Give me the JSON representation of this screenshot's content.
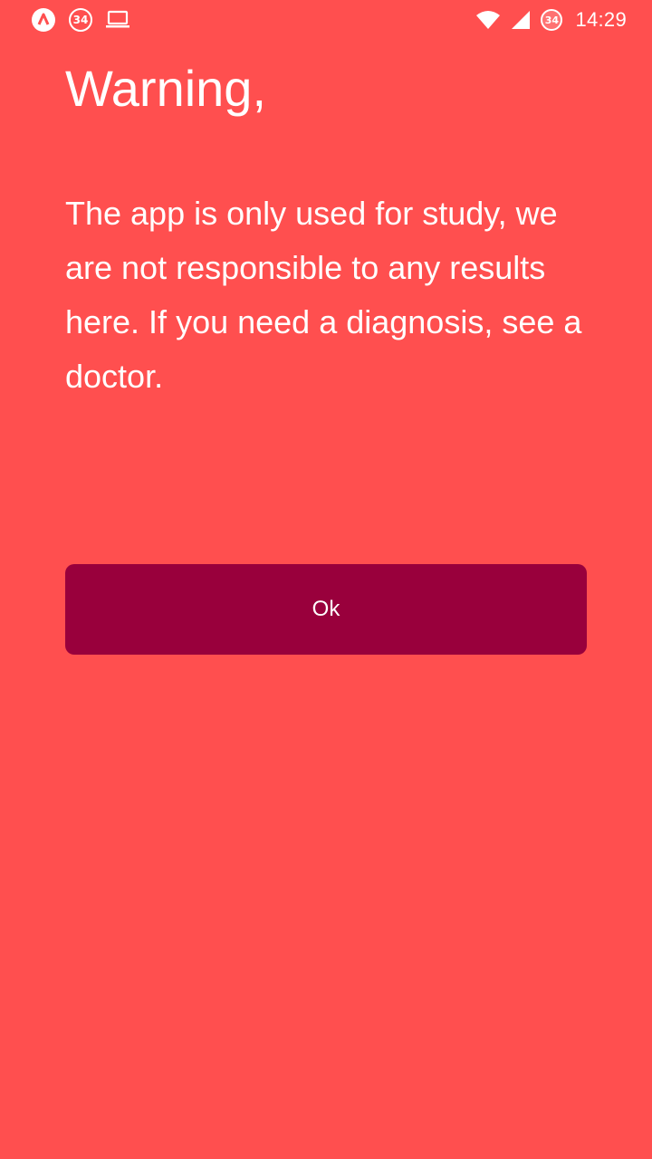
{
  "status_bar": {
    "left_icons": [
      "app-logo-icon",
      "notification-badge-icon",
      "laptop-icon"
    ],
    "notification_badge_text": "34",
    "right_icons": [
      "wifi-icon",
      "cell-signal-icon",
      "notification-badge-icon"
    ],
    "right_badge_text": "34",
    "time": "14:29"
  },
  "dialog": {
    "title": "Warning,",
    "message": "The app is only used for study, we are not responsible to any results here. If you need a diagnosis, see a doctor.",
    "ok_label": "Ok"
  },
  "colors": {
    "background": "#ff4f4f",
    "button": "#99003c",
    "text": "#ffffff"
  }
}
